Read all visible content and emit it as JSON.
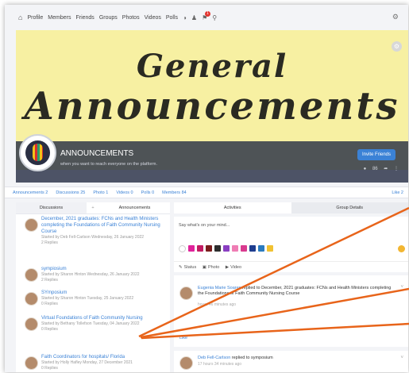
{
  "nav": {
    "items": [
      "Profile",
      "Members",
      "Friends",
      "Groups",
      "Photos",
      "Videos",
      "Polls"
    ],
    "notification_count": "1"
  },
  "banner": {
    "line1": "General",
    "line2": "Announcements"
  },
  "group": {
    "name": "ANNOUNCEMENTS",
    "description": "when you want to reach everyone on the platform.",
    "invite_label": "Invite Friends",
    "member_count": "86"
  },
  "stats": {
    "announcements": "Announcements 2",
    "discussions": "Discussions 25",
    "photos": "Photo 1",
    "videos": "Videos 0",
    "polls": "Polls 0",
    "members": "Members 84",
    "like": "Like 2"
  },
  "left_tabs": {
    "discussions": "Discussions",
    "plus": "+",
    "announcements": "Announcements"
  },
  "discussions": [
    {
      "title": "December, 2021 graduates: FCNs and Health Ministers completing the Foundations of Faith Community Nursing Course",
      "meta": "Started by Deb Fell-Carlson Wednesday, 26 January 2022",
      "replies": "2 Replies"
    },
    {
      "title": "sympiosium",
      "meta": "Started by Sharon Hinton Wednesday, 26 January 2022",
      "replies": "2 Replies"
    },
    {
      "title": "SYmposium",
      "meta": "Started by Sharon Hinton Tuesday, 25 January 2022",
      "replies": "0 Replies"
    },
    {
      "title": "Virtual Foundations of Faith Community Nursing",
      "meta": "Started by Bethany Tollefson Tuesday, 04 January 2022",
      "replies": "0 Replies"
    },
    {
      "title": "Faith Coordinators for hospitals/ Florida",
      "meta": "Started by Holly Hafley Monday, 27 December 2021",
      "replies": "0 Replies"
    }
  ],
  "right_tabs": {
    "activities": "Activities",
    "details": "Group Details"
  },
  "composer": {
    "placeholder": "Say what's on your mind...",
    "status": "Status",
    "photo": "Photo",
    "video": "Video"
  },
  "colors": {
    "swatches": [
      "#ffffff",
      "#e0229a",
      "#c31c63",
      "#7a1d1d",
      "#2d2d2d",
      "#8a3fc2",
      "#ef7db4",
      "#d93a8f",
      "#1e3d8f",
      "#2b7bbf",
      "#f1c232"
    ],
    "accent": "#3b82d6",
    "arrow": "#e8641a"
  },
  "feed": [
    {
      "author": "Eugenia Marie Soares",
      "text": "replied to December, 2021 graduates: FCNs and Health Ministers completing the Foundations of Faith Community Nursing Course",
      "time": "hours 46 minutes ago",
      "like": "Like"
    },
    {
      "author": "Deb Fell-Carlson",
      "text": "replied to symposium",
      "time": "17 hours 34 minutes ago"
    }
  ]
}
